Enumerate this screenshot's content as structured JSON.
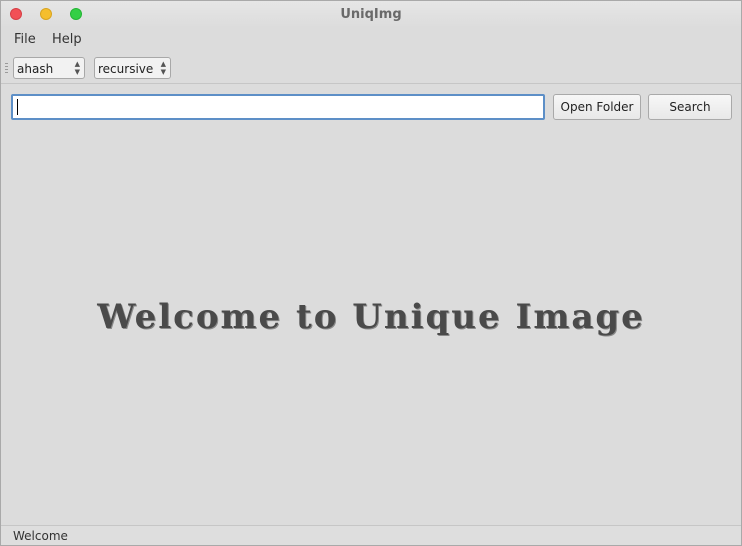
{
  "window": {
    "title": "UniqImg"
  },
  "menu": {
    "file": "File",
    "help": "Help"
  },
  "toolbar": {
    "hash_select": "ahash",
    "mode_select": "recursive"
  },
  "search": {
    "path_value": "",
    "placeholder": "",
    "open_folder_label": "Open Folder",
    "search_label": "Search"
  },
  "main": {
    "welcome_text": "Welcome to Unique Image"
  },
  "status": {
    "text": "Welcome"
  },
  "colors": {
    "close": "#f25056",
    "minimize": "#f5be2e",
    "maximize": "#33cf45",
    "input_focus": "#5d8fc7"
  },
  "icons": {
    "close": "close-icon",
    "minimize": "minimize-icon",
    "maximize": "maximize-icon",
    "select_arrows": "up-down-arrows-icon",
    "grip": "toolbar-grip-icon"
  }
}
